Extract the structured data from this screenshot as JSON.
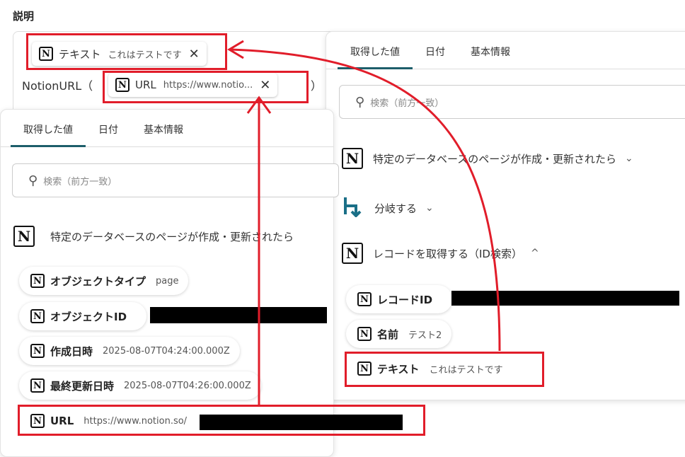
{
  "section_title": "説明",
  "description_box": {
    "chip_text": {
      "name": "テキスト",
      "value": "これはテストです"
    },
    "prefix": "NotionURL（",
    "suffix": "）",
    "chip_url": {
      "name": "URL",
      "value": "https://www.notio..."
    }
  },
  "left_panel": {
    "tabs": [
      "取得した値",
      "日付",
      "基本情報"
    ],
    "search_placeholder": "検索（前方一致）",
    "trigger_label": "特定のデータベースのページが作成・更新されたら",
    "items": [
      {
        "key": "オブジェクトタイプ",
        "value": "page"
      },
      {
        "key": "オブジェクトID",
        "value": ""
      },
      {
        "key": "作成日時",
        "value": "2025-08-07T04:24:00.000Z"
      },
      {
        "key": "最終更新日時",
        "value": "2025-08-07T04:26:00.000Z"
      },
      {
        "key": "URL",
        "value": "https://www.notion.so/"
      }
    ]
  },
  "right_panel": {
    "tabs": [
      "取得した値",
      "日付",
      "基本情報"
    ],
    "search_placeholder": "検索（前方一致）",
    "trigger_label": "特定のデータベースのページが作成・更新されたら",
    "branch_label": "分岐する",
    "record_label": "レコードを取得する（ID検索）",
    "items": [
      {
        "key": "レコードID",
        "value": ""
      },
      {
        "key": "名前",
        "value": "テスト2"
      },
      {
        "key": "テキスト",
        "value": "これはテストです"
      }
    ]
  },
  "icons": {
    "notion": "N",
    "close": "✕",
    "chevron_down": "⌄",
    "chevron_up": "^"
  },
  "colors": {
    "accent": "#1d5e6a",
    "annotation": "#e11d2a"
  }
}
